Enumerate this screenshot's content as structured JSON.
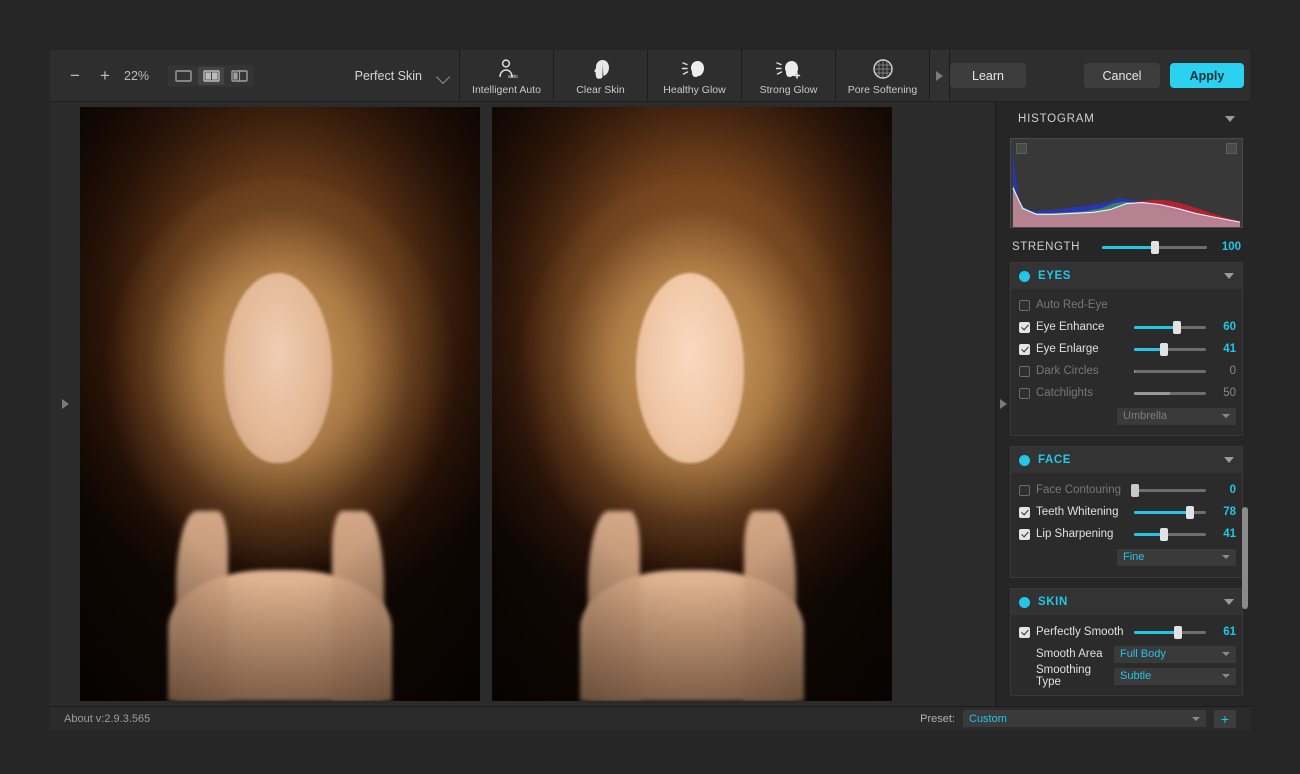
{
  "app": {
    "version_label": "About v:2.9.3.565"
  },
  "toolbar": {
    "zoom_out_icon": "minus-icon",
    "zoom_in_icon": "plus-icon",
    "zoom_level": "22%",
    "view_modes": [
      {
        "name": "single-view",
        "icon": "single-pane-icon",
        "active": false
      },
      {
        "name": "split-view",
        "icon": "two-pane-icon",
        "active": true
      },
      {
        "name": "compare-view",
        "icon": "split-compare-icon",
        "active": false
      }
    ],
    "mode_label": "Perfect Skin",
    "mode_chevron_icon": "chevron-down-icon",
    "tools": [
      {
        "label": "Intelligent Auto",
        "icon": "face-auto-icon"
      },
      {
        "label": "Clear Skin",
        "icon": "face-profile-icon"
      },
      {
        "label": "Healthy Glow",
        "icon": "face-glow-icon"
      },
      {
        "label": "Strong Glow",
        "icon": "face-strong-glow-icon"
      },
      {
        "label": "Pore Softening",
        "icon": "pore-circle-icon"
      }
    ],
    "tools_next_icon": "chevron-right-icon",
    "learn_label": "Learn",
    "cancel_label": "Cancel",
    "apply_label": "Apply",
    "accent_color": "#2ad2f0"
  },
  "canvas": {
    "left_handle_icon": "panel-expand-right-icon",
    "right_handle_icon": "panel-expand-right-icon",
    "before_image_alt": "Portrait before retouching",
    "after_image_alt": "Portrait after retouching"
  },
  "panel": {
    "histogram": {
      "title": "HISTOGRAM",
      "caret_icon": "caret-down-icon",
      "left_handle_name": "histogram-black-point-handle",
      "right_handle_name": "histogram-white-point-handle"
    },
    "strength": {
      "label": "STRENGTH",
      "value": "100",
      "percent": 50
    },
    "sections": [
      {
        "id": "eyes",
        "title": "EYES",
        "dot_color": "#23c6e8",
        "caret_icon": "caret-down-icon",
        "controls": [
          {
            "type": "checkbox-only",
            "label": "Auto Red-Eye",
            "checked": false,
            "enabled": false
          },
          {
            "type": "slider",
            "label": "Eye Enhance",
            "checked": true,
            "enabled": true,
            "value": "60",
            "percent": 60
          },
          {
            "type": "slider",
            "label": "Eye Enlarge",
            "checked": true,
            "enabled": true,
            "value": "41",
            "percent": 41
          },
          {
            "type": "slider",
            "label": "Dark Circles",
            "checked": false,
            "enabled": false,
            "value": "0",
            "percent": 0
          },
          {
            "type": "slider",
            "label": "Catchlights",
            "checked": false,
            "enabled": false,
            "value": "50",
            "percent": 50
          },
          {
            "type": "dropdown-indent",
            "value": "Umbrella",
            "enabled": false
          }
        ]
      },
      {
        "id": "face",
        "title": "FACE",
        "dot_color": "#23c6e8",
        "caret_icon": "caret-down-icon",
        "controls": [
          {
            "type": "slider",
            "label": "Face Contouring",
            "checked": false,
            "enabled": false,
            "value": "0",
            "percent": 0
          },
          {
            "type": "slider",
            "label": "Teeth Whitening",
            "checked": true,
            "enabled": true,
            "value": "78",
            "percent": 78
          },
          {
            "type": "slider",
            "label": "Lip Sharpening",
            "checked": true,
            "enabled": true,
            "value": "41",
            "percent": 41
          },
          {
            "type": "dropdown-indent",
            "value": "Fine",
            "enabled": true
          }
        ]
      },
      {
        "id": "skin",
        "title": "SKIN",
        "dot_color": "#23c6e8",
        "caret_icon": "caret-down-icon",
        "controls": [
          {
            "type": "slider",
            "label": "Perfectly Smooth",
            "checked": true,
            "enabled": true,
            "value": "61",
            "percent": 61
          },
          {
            "type": "dropdown-row",
            "label": "Smooth Area",
            "value": "Full Body",
            "enabled": true
          },
          {
            "type": "dropdown-row",
            "label": "Smoothing Type",
            "value": "Subtle",
            "enabled": true
          }
        ]
      }
    ],
    "scrollbar_name": "panel-scrollbar"
  },
  "statusbar": {
    "preset_label": "Preset:",
    "preset_value": "Custom",
    "add_preset_icon": "plus-icon"
  }
}
